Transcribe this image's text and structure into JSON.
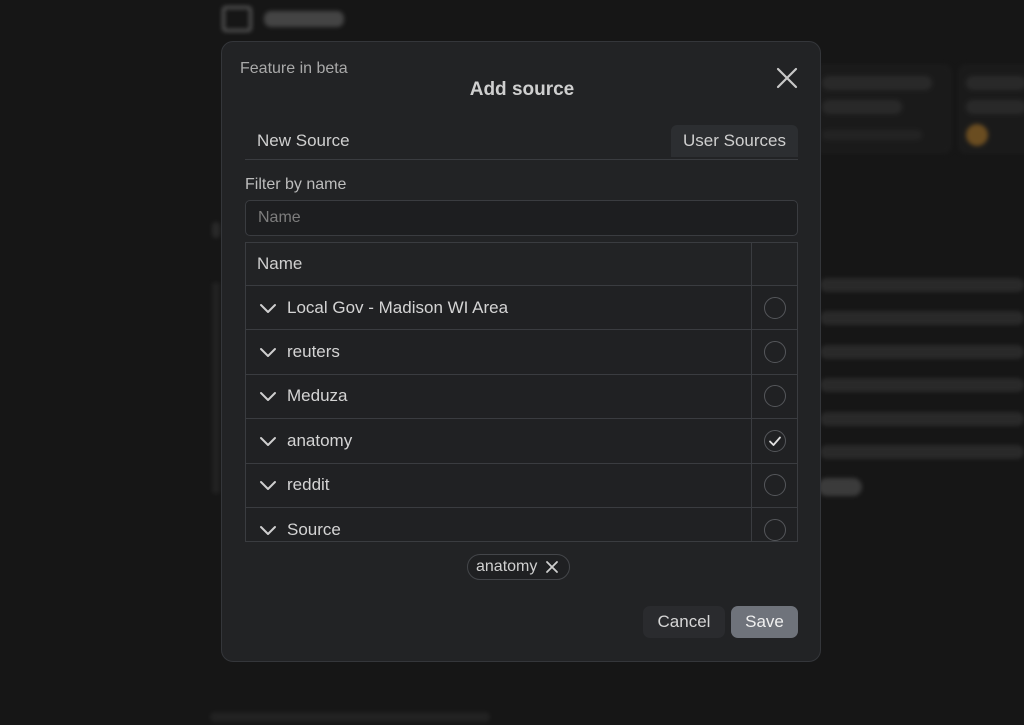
{
  "modal": {
    "beta_label": "Feature in beta",
    "title": "Add source",
    "close_icon": "close-icon"
  },
  "tabs": [
    {
      "label": "New Source",
      "active": false
    },
    {
      "label": "User Sources",
      "active": true
    }
  ],
  "filter": {
    "label": "Filter by name",
    "placeholder": "Name",
    "value": ""
  },
  "table": {
    "header_name": "Name",
    "rows": [
      {
        "label": "Local Gov - Madison WI Area",
        "checked": false
      },
      {
        "label": "reuters",
        "checked": false
      },
      {
        "label": "Meduza",
        "checked": false
      },
      {
        "label": "anatomy",
        "checked": true
      },
      {
        "label": "reddit",
        "checked": false
      },
      {
        "label": "Source",
        "checked": false
      }
    ]
  },
  "selected_chips": [
    {
      "label": "anatomy"
    }
  ],
  "footer": {
    "cancel_label": "Cancel",
    "save_label": "Save"
  },
  "colors": {
    "modal_bg": "#222325",
    "save_button": "#6f737b",
    "backdrop": "#161616"
  }
}
